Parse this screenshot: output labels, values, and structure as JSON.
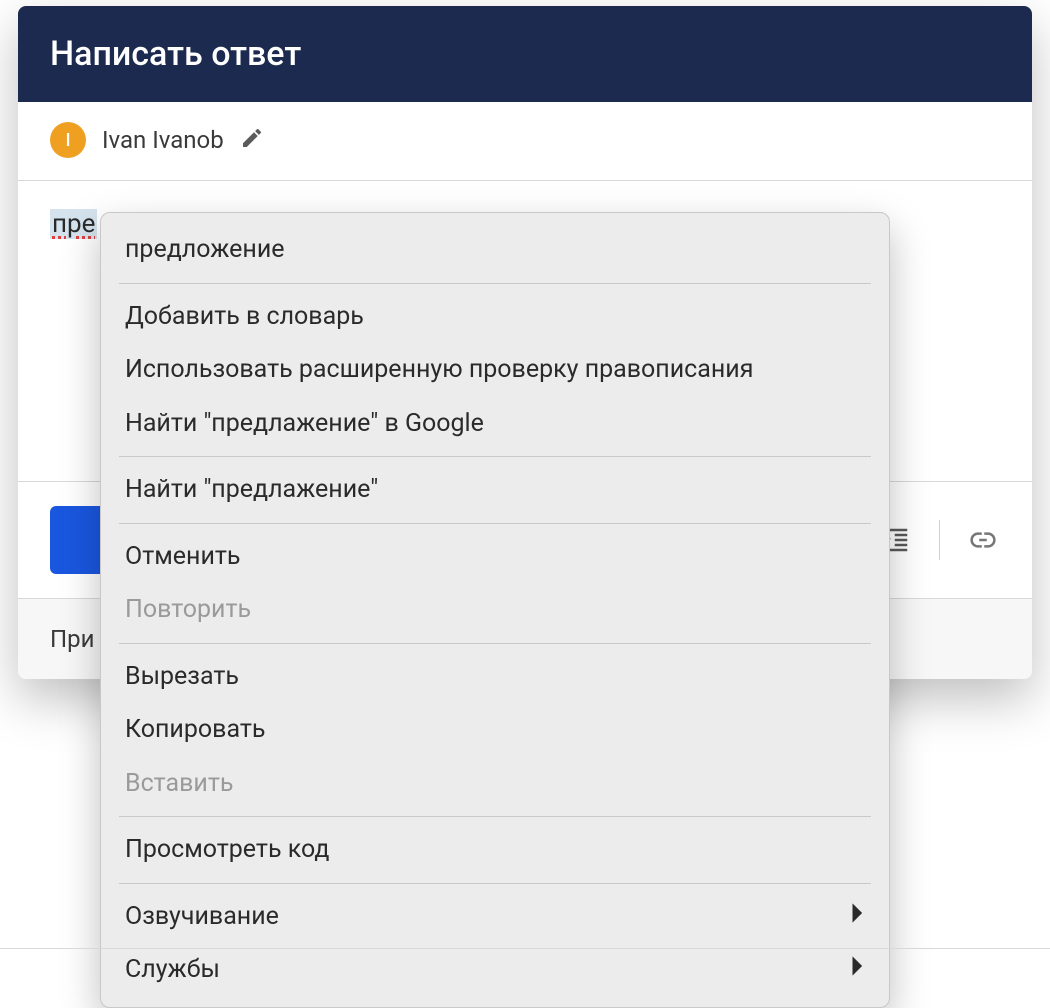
{
  "header": {
    "title": "Написать ответ"
  },
  "author": {
    "initial": "I",
    "name": "Ivan Ivanob"
  },
  "editor": {
    "misspelled_word": "пре"
  },
  "footer": {
    "attach_prefix": "При"
  },
  "context_menu": {
    "suggestion": "предложение",
    "group_spell": {
      "add_to_dict": "Добавить в словарь",
      "use_extended": "Использовать расширенную проверку правописания",
      "search_google": "Найти \"предлажение\" в Google"
    },
    "group_find": {
      "find": "Найти \"предлажение\""
    },
    "group_undo": {
      "undo": "Отменить",
      "redo": "Повторить"
    },
    "group_clip": {
      "cut": "Вырезать",
      "copy": "Копировать",
      "paste": "Вставить"
    },
    "group_code": {
      "view_source": "Просмотреть код"
    },
    "group_speech": {
      "speech": "Озвучивание",
      "services": "Службы"
    }
  }
}
